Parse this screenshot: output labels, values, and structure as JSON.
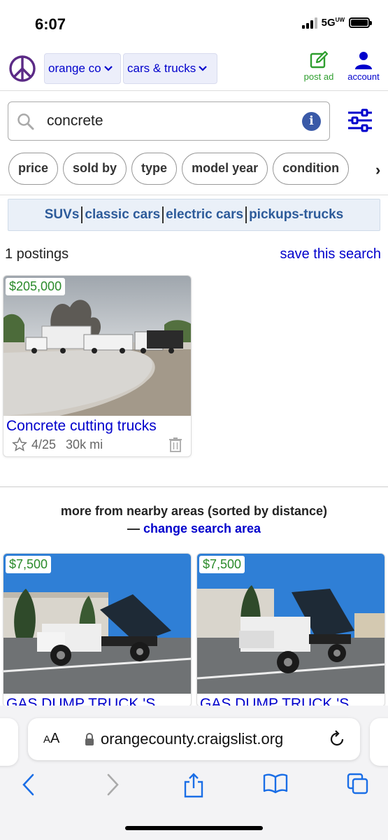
{
  "status_bar": {
    "time": "6:07",
    "network": "5G",
    "network_suffix": "UW"
  },
  "header": {
    "location": "orange co",
    "category": "cars & trucks",
    "post_ad": "post ad",
    "account": "account"
  },
  "search": {
    "value": "concrete",
    "placeholder": ""
  },
  "filters": [
    "price",
    "sold by",
    "type",
    "model year",
    "condition"
  ],
  "quick_links": [
    "SUVs",
    "classic cars",
    "electric cars",
    "pickups-trucks"
  ],
  "results": {
    "count": "1 postings",
    "save_search": "save this search",
    "postings": [
      {
        "price": "$205,000",
        "title": "Concrete cutting trucks",
        "date": "4/25",
        "mileage": "30k mi"
      }
    ]
  },
  "nearby": {
    "heading": "more from nearby areas (sorted by distance)",
    "dash": "—",
    "link": "change search area",
    "postings": [
      {
        "price": "$7,500",
        "title": "GAS DUMP TRUCK 'S"
      },
      {
        "price": "$7,500",
        "title": "GAS DUMP TRUCK 'S"
      }
    ]
  },
  "browser": {
    "aa_small": "A",
    "aa_large": "A",
    "url": "orangecounty.craigslist.org"
  },
  "colors": {
    "link": "#0000cc",
    "price": "#2a8a2a",
    "peace": "#5b2a86",
    "post_ad": "#2e9e2e"
  }
}
